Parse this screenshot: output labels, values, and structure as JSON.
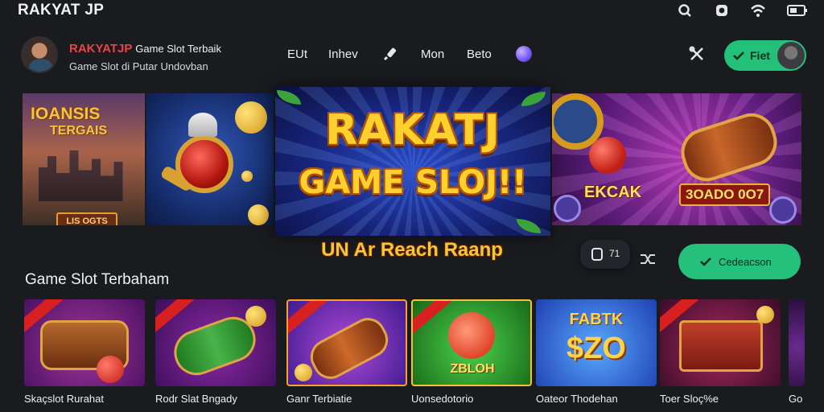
{
  "app": {
    "title": "RAKYAT JP"
  },
  "header": {
    "brand_name": "RAKYATJP",
    "brand_tag": "Game Slot Terbaik",
    "brand_sub": "Game Slot di Putar Undovban",
    "nav": [
      "EUt",
      "Inhev",
      "Mon",
      "Beto"
    ],
    "button_label": "Fiet"
  },
  "banner": {
    "tile_a_line1": "IOANSIS",
    "tile_a_line2": "TERGAIS",
    "tile_a_plate": "LIS OGTS",
    "title_line1": "RAKATJ",
    "title_line2": "GAME SLOJ!!",
    "tile_d_label1": "EKCAK",
    "tile_d_label2": "3OADO 0O7",
    "tagline": "UN Ar Reach Raanp"
  },
  "controls": {
    "pill_count": "71",
    "primary_label": "Cedeacson"
  },
  "section": {
    "title": "Game Slot Terbaham"
  },
  "games": [
    {
      "title": "Skaçslot Rurahat",
      "meta": ""
    },
    {
      "title": "Rodr Slat Bngady",
      "meta": ""
    },
    {
      "title": "Ganr Terbiatie",
      "meta": ""
    },
    {
      "title": "Uonsedotorio",
      "meta": ""
    },
    {
      "title": "Oateor Thodehan",
      "meta": ""
    },
    {
      "title": "Toer Sloç%e",
      "meta": ""
    },
    {
      "title": "Go",
      "meta": ""
    }
  ],
  "game_art_labels": [
    "FABTK",
    "$ZO",
    "ZBLOH"
  ],
  "icons": [
    "search-icon",
    "camera-icon",
    "wifi-icon",
    "battery-icon",
    "brush-icon",
    "tools-icon",
    "check-icon",
    "shuffle-icon",
    "copy-icon"
  ],
  "colors": {
    "accent_green": "#25c07b",
    "brand_red": "#e84545",
    "gold": "#ffd02e",
    "background": "#1a1b1f"
  }
}
